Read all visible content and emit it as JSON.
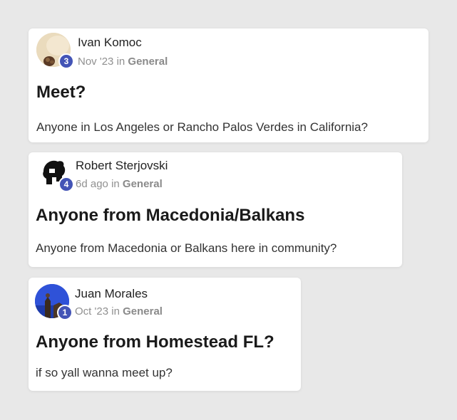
{
  "posts": [
    {
      "author": "Ivan Komoc",
      "level": "3",
      "time": "Nov '23",
      "in_word": "in",
      "category": "General",
      "title": "Meet?",
      "body": "Anyone in Los Angeles or Rancho Palos Verdes in California?",
      "avatar_colors": {
        "bg": "#e8d3b2",
        "accent": "#6b4a2f"
      }
    },
    {
      "author": "Robert Sterjovski",
      "level": "4",
      "time": "6d ago",
      "in_word": "in",
      "category": "General",
      "title": "Anyone from Macedonia/Balkans",
      "body": "Anyone from Macedonia or Balkans here in community?",
      "avatar_colors": {
        "bg": "#ffffff",
        "accent": "#111111"
      }
    },
    {
      "author": "Juan Morales",
      "level": "1",
      "time": "Oct '23",
      "in_word": "in",
      "category": "General",
      "title": "Anyone from Homestead FL?",
      "body": "if so yall wanna meet up?",
      "avatar_colors": {
        "bg": "#2a4fd6",
        "accent": "#3a2a1e"
      }
    }
  ],
  "colors": {
    "page_bg": "#e8e8e8",
    "card_bg": "#ffffff",
    "badge": "#4354b6",
    "meta_text": "#909090"
  }
}
